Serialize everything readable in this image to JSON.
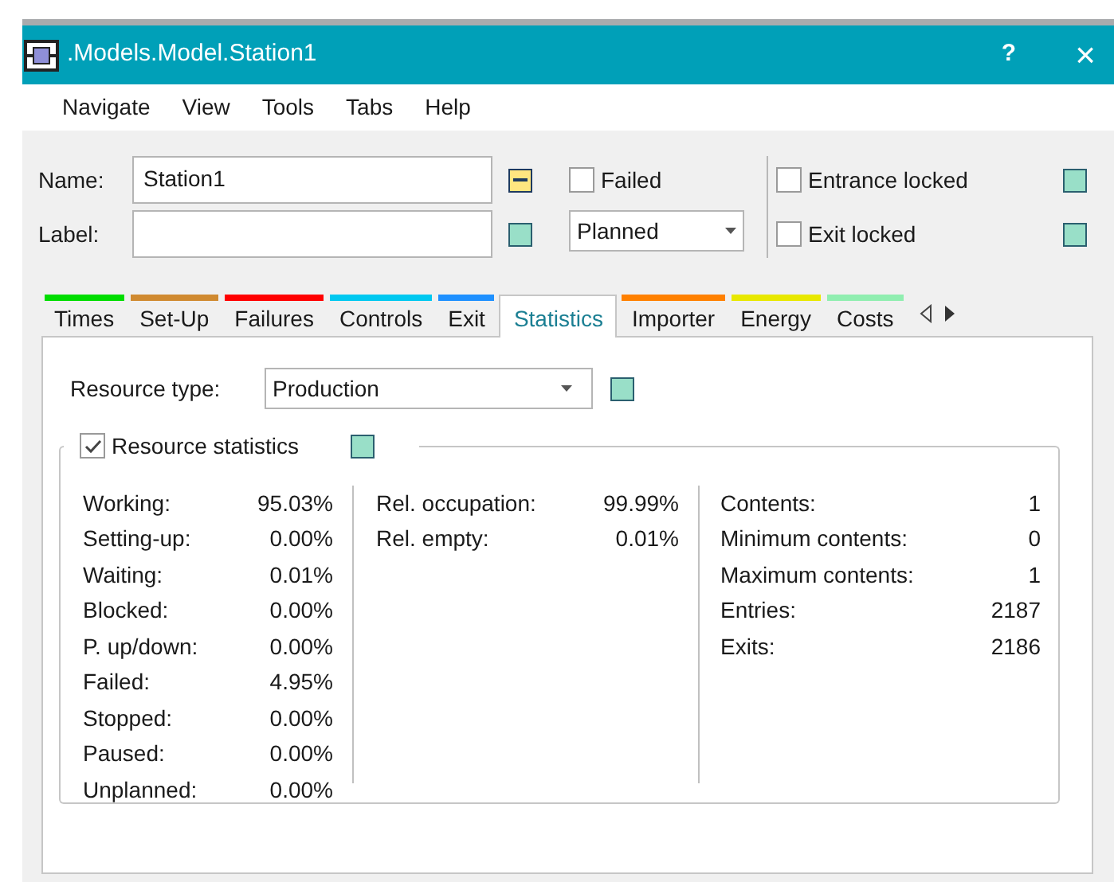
{
  "window": {
    "title": ".Models.Model.Station1",
    "help": "?",
    "close": "×"
  },
  "menu": [
    "Navigate",
    "View",
    "Tools",
    "Tabs",
    "Help"
  ],
  "name_field": {
    "label": "Name:",
    "value": "Station1",
    "inherited": false
  },
  "label_field": {
    "label": "Label:",
    "inherited": true
  },
  "failed": {
    "label": "Failed",
    "checked": false
  },
  "plan_select": {
    "value": "Planned"
  },
  "entrance_locked": {
    "label": "Entrance locked",
    "checked": false,
    "inherited": true
  },
  "exit_locked": {
    "label": "Exit locked",
    "checked": false,
    "inherited": true
  },
  "tabs": [
    {
      "label": "Times",
      "selected": false,
      "color": "#00dd00"
    },
    {
      "label": "Set-Up",
      "selected": false,
      "color": "#d08a30"
    },
    {
      "label": "Failures",
      "selected": false,
      "color": "#ff0000"
    },
    {
      "label": "Controls",
      "selected": false,
      "color": "#00c8f0"
    },
    {
      "label": "Exit",
      "selected": false,
      "color": "#1e90ff"
    },
    {
      "label": "Statistics",
      "selected": true
    },
    {
      "label": "Importer",
      "selected": false,
      "color": "#ff8000"
    },
    {
      "label": "Energy",
      "selected": false,
      "color": "#e8e800"
    },
    {
      "label": "Costs",
      "selected": false,
      "color": "#90eeb0"
    }
  ],
  "resource_type": {
    "label": "Resource type:",
    "value": "Production",
    "inherited": true
  },
  "resource_statistics": {
    "label": "Resource statistics",
    "checked": true,
    "inherited": true
  },
  "stat_columns": [
    [
      {
        "label": "Working:",
        "value": "95.03%"
      },
      {
        "label": "Setting-up:",
        "value": "0.00%"
      },
      {
        "label": "Waiting:",
        "value": "0.01%"
      },
      {
        "label": "Blocked:",
        "value": "0.00%"
      },
      {
        "label": "P. up/down:",
        "value": "0.00%"
      },
      {
        "label": "Failed:",
        "value": "4.95%"
      },
      {
        "label": "Stopped:",
        "value": "0.00%"
      },
      {
        "label": "Paused:",
        "value": "0.00%"
      },
      {
        "label": "Unplanned:",
        "value": "0.00%"
      }
    ],
    [
      {
        "label": "Rel. occupation:",
        "value": "99.99%"
      },
      {
        "label": "Rel. empty:",
        "value": "0.01%"
      }
    ],
    [
      {
        "label": "Contents:",
        "value": "1"
      },
      {
        "label": "Minimum contents:",
        "value": "0"
      },
      {
        "label": "Maximum contents:",
        "value": "1"
      },
      {
        "label": "Entries:",
        "value": "2187"
      },
      {
        "label": "Exits:",
        "value": "2186"
      }
    ]
  ]
}
